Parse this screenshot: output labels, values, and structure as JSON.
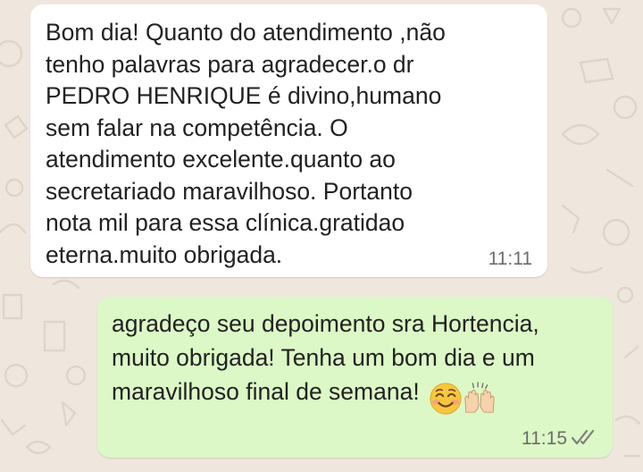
{
  "chat": {
    "incoming_message": {
      "text": "Bom  dia! Quanto do atendimento ,não\ntenho palavras para agradecer.o dr\nPEDRO HENRIQUE   é  divino,humano\nsem falar na competência. O\natendimento excelente.quanto ao\nsecretariado  maravilhoso. Portanto\nnota mil para essa clínica.gratidao\neterna.muito obrigada.",
      "time": "11:11"
    },
    "outgoing_message": {
      "text": "agradeço seu depoimento sra Hortencia,\nmuito obrigada! Tenha um bom dia e um\nmaravilhoso final de semana!",
      "time": "11:15",
      "status_icon": "double-check-icon",
      "emojis": [
        "smiling-face-with-smiling-eyes-icon",
        "raising-hands-icon"
      ]
    },
    "colors": {
      "wallpaper": "#efe7de",
      "incoming_bubble": "#ffffff",
      "outgoing_bubble": "#dcf8c6",
      "timestamp_text": "#6c6c6c"
    }
  }
}
